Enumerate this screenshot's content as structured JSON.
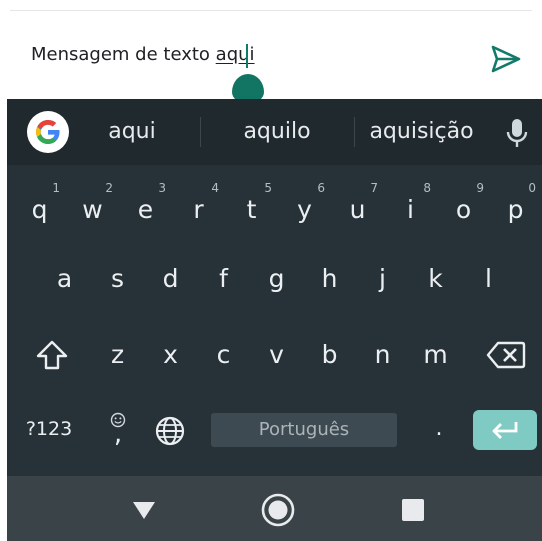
{
  "message": {
    "text_before": "Mensagem de texto ",
    "composing_word": "aqui"
  },
  "icons": {
    "send": "send-icon",
    "google": "google-g-icon",
    "mic": "mic-icon",
    "shift": "shift-icon",
    "backspace": "backspace-icon",
    "emoji": "emoji-icon",
    "globe": "globe-icon",
    "enter": "enter-icon",
    "nav_back": "back-triangle-icon",
    "nav_home": "home-circle-icon",
    "nav_recents": "recents-square-icon"
  },
  "colors": {
    "accent": "#137a6a",
    "keyboard_bg": "#263238",
    "suggestion_bg": "#1f292e",
    "enter_bg": "#7fcbc4",
    "nav_bg": "#3a4347"
  },
  "suggestions": [
    "aqui",
    "aquilo",
    "aquisição"
  ],
  "keyboard": {
    "row1": [
      {
        "label": "q",
        "hint": "1"
      },
      {
        "label": "w",
        "hint": "2"
      },
      {
        "label": "e",
        "hint": "3"
      },
      {
        "label": "r",
        "hint": "4"
      },
      {
        "label": "t",
        "hint": "5"
      },
      {
        "label": "y",
        "hint": "6"
      },
      {
        "label": "u",
        "hint": "7"
      },
      {
        "label": "i",
        "hint": "8"
      },
      {
        "label": "o",
        "hint": "9"
      },
      {
        "label": "p",
        "hint": "0"
      }
    ],
    "row2": [
      "a",
      "s",
      "d",
      "f",
      "g",
      "h",
      "j",
      "k",
      "l"
    ],
    "row3": [
      "z",
      "x",
      "c",
      "v",
      "b",
      "n",
      "m"
    ],
    "symbols_label": "?123",
    "comma_label": ",",
    "space_label": "Português",
    "period_label": "."
  }
}
